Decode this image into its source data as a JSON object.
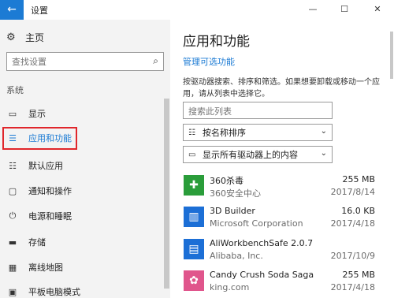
{
  "window": {
    "title": "设置",
    "back_glyph": "←",
    "min_glyph": "—",
    "max_glyph": "☐",
    "close_glyph": "✕"
  },
  "sidebar": {
    "home_label": "主页",
    "home_icon": "gear-icon",
    "search_placeholder": "查找设置",
    "section_label": "系统",
    "items": [
      {
        "label": "显示",
        "icon": "display-icon",
        "glyph": "▭"
      },
      {
        "label": "应用和功能",
        "icon": "list-icon",
        "glyph": "☰",
        "active": true
      },
      {
        "label": "默认应用",
        "icon": "default-apps-icon",
        "glyph": "☷"
      },
      {
        "label": "通知和操作",
        "icon": "notification-icon",
        "glyph": "▢"
      },
      {
        "label": "电源和睡眠",
        "icon": "power-icon",
        "glyph": "⏻"
      },
      {
        "label": "存储",
        "icon": "storage-icon",
        "glyph": "▬"
      },
      {
        "label": "离线地图",
        "icon": "map-icon",
        "glyph": "▦"
      },
      {
        "label": "平板电脑模式",
        "icon": "tablet-icon",
        "glyph": "▣"
      }
    ]
  },
  "main": {
    "title": "应用和功能",
    "manage_link": "管理可选功能",
    "description": "按驱动器搜索、排序和筛选。如果想要卸载或移动一个应用，请从列表中选择它。",
    "filter_placeholder": "搜索此列表",
    "sort_label": "按名称排序",
    "drive_label": "显示所有驱动器上的内容",
    "apps": [
      {
        "name": "360杀毒",
        "publisher": "360安全中心",
        "size": "255 MB",
        "date": "2017/8/14",
        "icon_color": "#2a9d3a",
        "icon_glyph": "✚"
      },
      {
        "name": "3D Builder",
        "publisher": "Microsoft Corporation",
        "size": "16.0 KB",
        "date": "2017/4/18",
        "icon_color": "#1c6fd6",
        "icon_glyph": "▥"
      },
      {
        "name": "AliWorkbenchSafe 2.0.7",
        "publisher": "Alibaba, Inc.",
        "size": "",
        "date": "2017/10/9",
        "icon_color": "#1c6fd6",
        "icon_glyph": "▤"
      },
      {
        "name": "Candy Crush Soda Saga",
        "publisher": "king.com",
        "size": "255 MB",
        "date": "2017/4/18",
        "icon_color": "#e0558c",
        "icon_glyph": "✿"
      }
    ]
  },
  "colors": {
    "accent": "#1c7bd4",
    "highlight_border": "#e0262b"
  }
}
